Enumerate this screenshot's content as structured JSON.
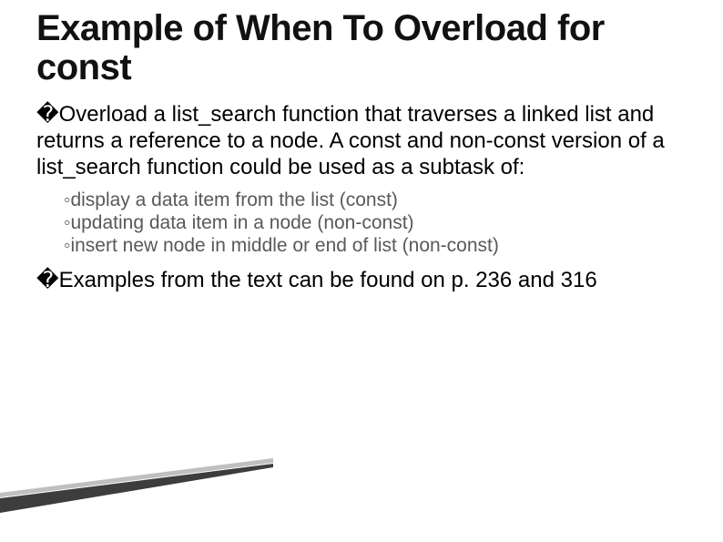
{
  "title": "Example of When To Overload for const",
  "bullets": [
    {
      "marker": "�",
      "text": "Overload a list_search function that traverses a linked list and returns a reference to a node. A const and non-const version of a list_search function could be used as a subtask of:"
    },
    {
      "marker": "�",
      "text": "Examples from the text can be found on p. 236 and 316"
    }
  ],
  "sublist_marker": "◦",
  "sublist": [
    "display a data item from the list (const)",
    "updating data item in a node (non-const)",
    "insert new node in middle or end of list (non-const)"
  ]
}
